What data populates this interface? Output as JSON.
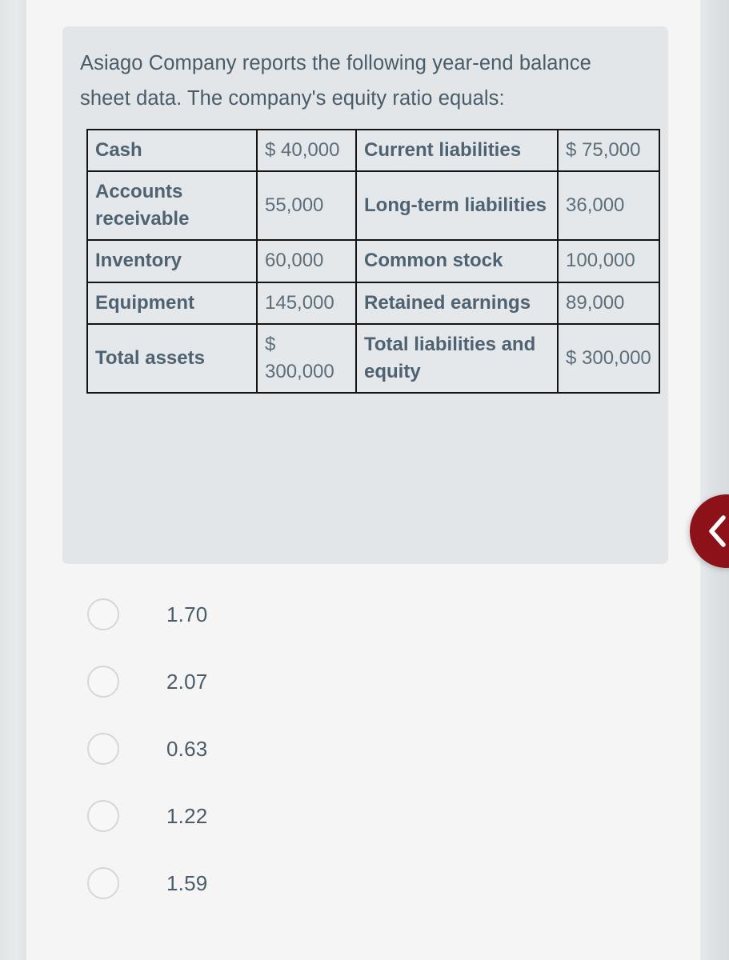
{
  "question": {
    "text": "Asiago Company reports the following year-end balance sheet data. The company's equity ratio equals:"
  },
  "balance_sheet": {
    "rows": [
      {
        "asset_label": "Cash",
        "asset_value": "$ 40,000",
        "claim_label": "Current liabilities",
        "claim_value": "$ 75,000"
      },
      {
        "asset_label": "Accounts receivable",
        "asset_value": "55,000",
        "claim_label": "Long-term liabilities",
        "claim_value": "36,000"
      },
      {
        "asset_label": "Inventory",
        "asset_value": "60,000",
        "claim_label": "Common stock",
        "claim_value": "100,000"
      },
      {
        "asset_label": "Equipment",
        "asset_value": "145,000",
        "claim_label": "Retained earnings",
        "claim_value": "89,000"
      },
      {
        "asset_label": "Total assets",
        "asset_value": "$ 300,000",
        "claim_label": "Total liabilities and equity",
        "claim_value": "$ 300,000"
      }
    ]
  },
  "options": [
    {
      "label": "1.70"
    },
    {
      "label": "2.07"
    },
    {
      "label": "0.63"
    },
    {
      "label": "1.22"
    },
    {
      "label": "1.59"
    }
  ],
  "collapse_button": {
    "icon": "chevron-left-icon",
    "color": "#8c1119"
  },
  "colors": {
    "panel_background": "#e2e6e9",
    "card_background": "#f5f5f6",
    "page_background": "#e3e6e8",
    "text": "#4a5c68",
    "table_border": "#141414",
    "accent_red": "#8c1119"
  }
}
